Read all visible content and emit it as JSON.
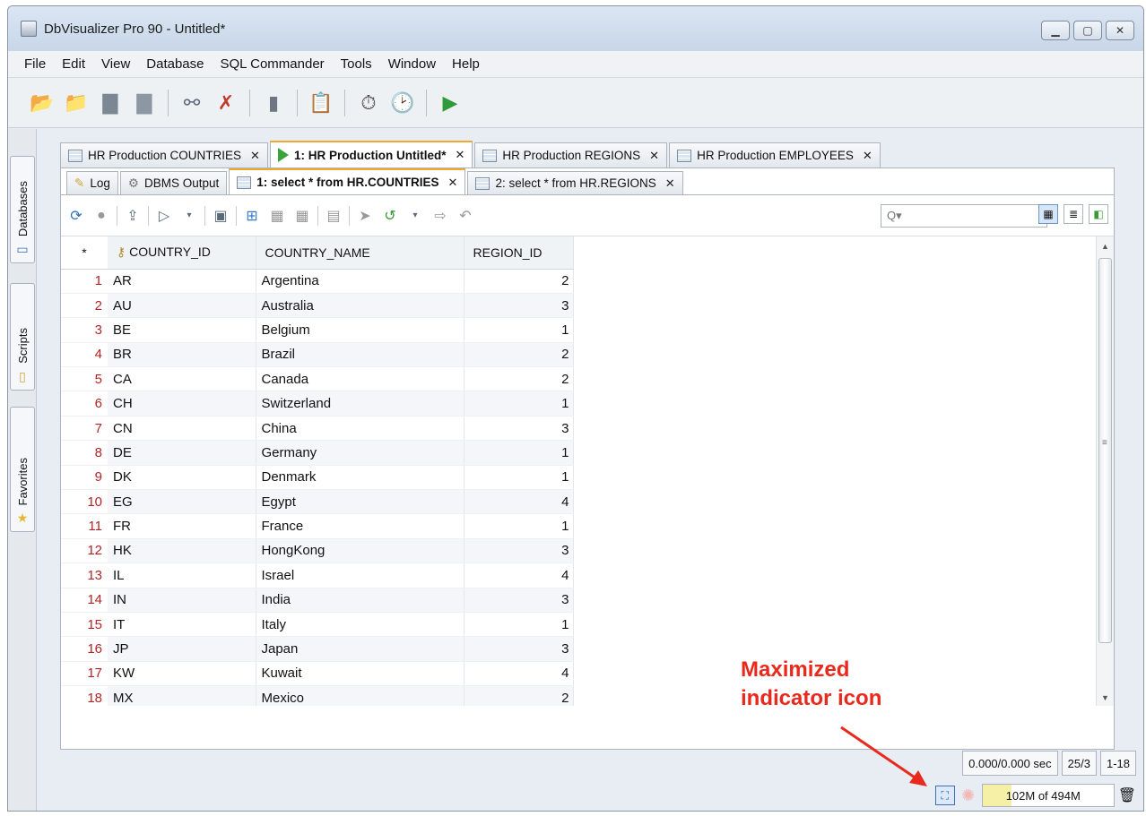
{
  "window": {
    "title": "DbVisualizer Pro 90 - Untitled*"
  },
  "menu": [
    "File",
    "Edit",
    "View",
    "Database",
    "SQL Commander",
    "Tools",
    "Window",
    "Help"
  ],
  "sidebar": {
    "tabs": [
      "Databases",
      "Scripts",
      "Favorites"
    ]
  },
  "doc_tabs": [
    {
      "label": "HR Production COUNTRIES",
      "active": false
    },
    {
      "label": "1: HR Production Untitled*",
      "active": true
    },
    {
      "label": "HR Production REGIONS",
      "active": false
    },
    {
      "label": "HR Production EMPLOYEES",
      "active": false
    }
  ],
  "sub_tabs": [
    {
      "label": "Log"
    },
    {
      "label": "DBMS Output"
    },
    {
      "label": "1: select * from HR.COUNTRIES"
    },
    {
      "label": "2: select * from HR.REGIONS"
    }
  ],
  "search": {
    "placeholder": "Q▾"
  },
  "table": {
    "marker": "*",
    "columns": [
      "COUNTRY_ID",
      "COUNTRY_NAME",
      "REGION_ID"
    ],
    "rows": [
      [
        "1",
        "AR",
        "Argentina",
        "2"
      ],
      [
        "2",
        "AU",
        "Australia",
        "3"
      ],
      [
        "3",
        "BE",
        "Belgium",
        "1"
      ],
      [
        "4",
        "BR",
        "Brazil",
        "2"
      ],
      [
        "5",
        "CA",
        "Canada",
        "2"
      ],
      [
        "6",
        "CH",
        "Switzerland",
        "1"
      ],
      [
        "7",
        "CN",
        "China",
        "3"
      ],
      [
        "8",
        "DE",
        "Germany",
        "1"
      ],
      [
        "9",
        "DK",
        "Denmark",
        "1"
      ],
      [
        "10",
        "EG",
        "Egypt",
        "4"
      ],
      [
        "11",
        "FR",
        "France",
        "1"
      ],
      [
        "12",
        "HK",
        "HongKong",
        "3"
      ],
      [
        "13",
        "IL",
        "Israel",
        "4"
      ],
      [
        "14",
        "IN",
        "India",
        "3"
      ],
      [
        "15",
        "IT",
        "Italy",
        "1"
      ],
      [
        "16",
        "JP",
        "Japan",
        "3"
      ],
      [
        "17",
        "KW",
        "Kuwait",
        "4"
      ],
      [
        "18",
        "MX",
        "Mexico",
        "2"
      ]
    ]
  },
  "status": {
    "timing": "0.000/0.000 sec",
    "rowcols": "25/3",
    "range": "1-18",
    "memory": "102M of 494M"
  },
  "annotation": {
    "line1": "Maximized",
    "line2": "indicator icon",
    "color": "#e8291c"
  }
}
